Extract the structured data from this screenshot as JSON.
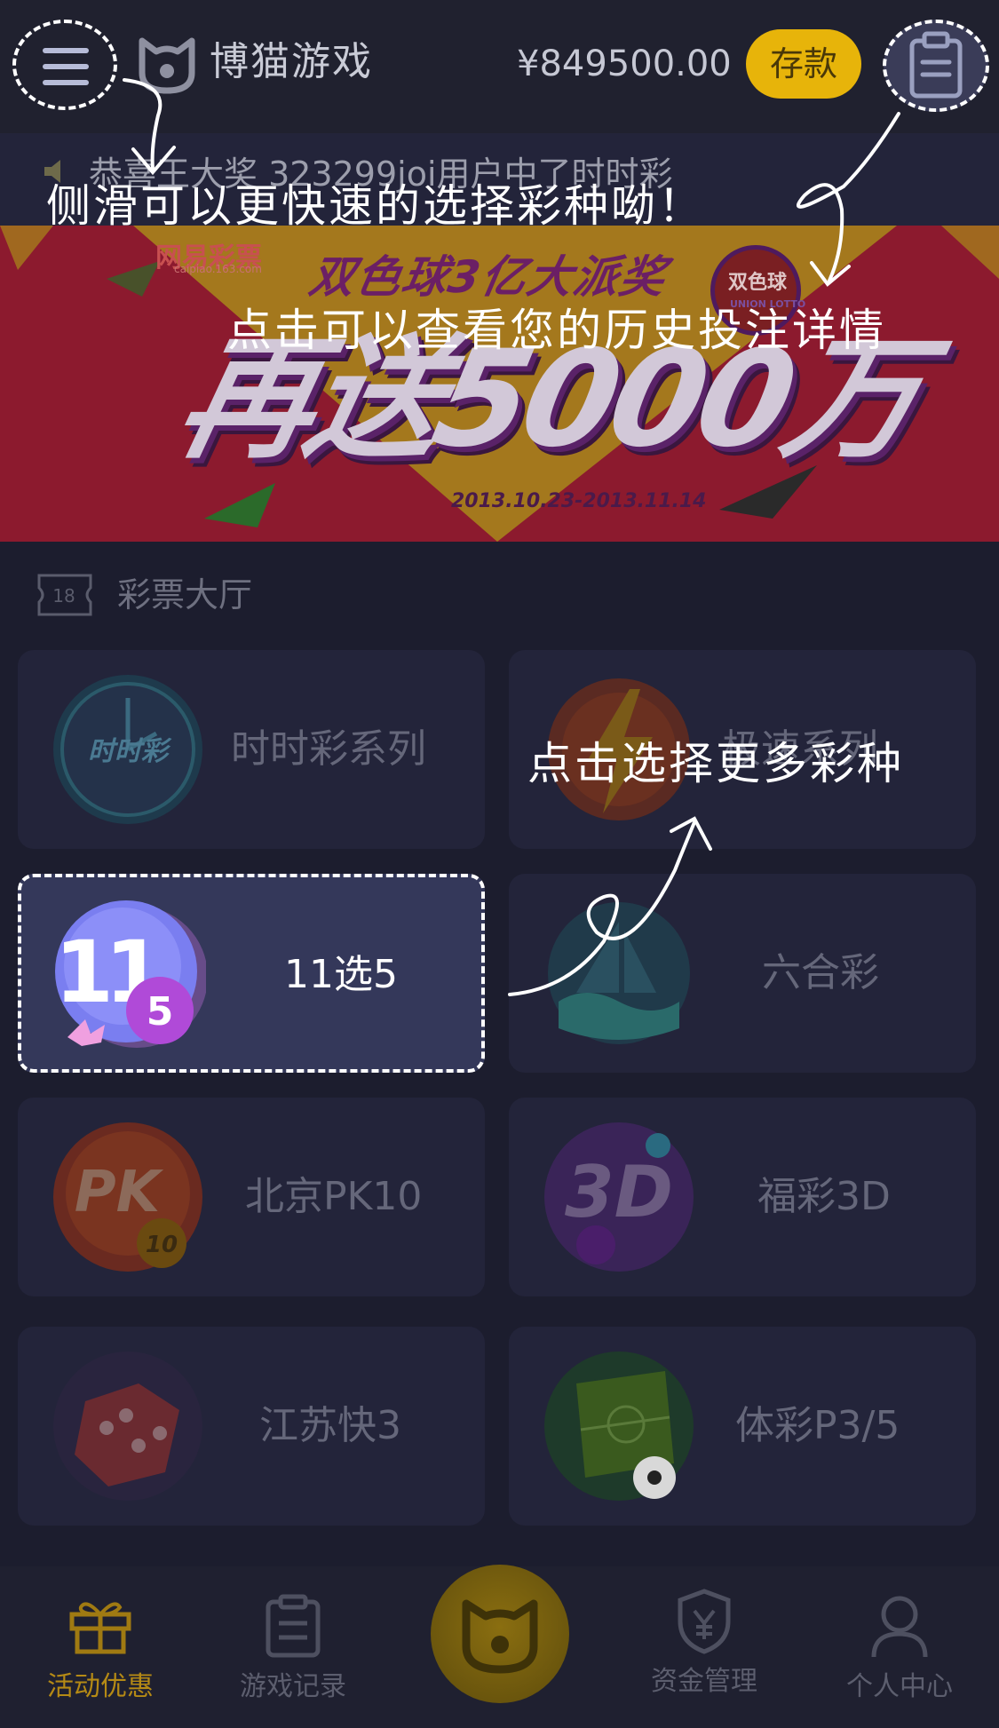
{
  "header": {
    "brand": "博猫游戏",
    "balance": "¥849500.00",
    "deposit_label": "存款"
  },
  "marquee": {
    "text": "恭喜王大奖  323299joi用户中了时时彩"
  },
  "banner": {
    "brand": "网易彩票",
    "domain": "caipiao.163.com",
    "headline": "双色球3亿大派奖",
    "big_text": "再送5000万",
    "date_range": "2013.10.23-2013.11.14",
    "badge_top": "双色球",
    "badge_bottom": "UNION LOTTO"
  },
  "section": {
    "icon_text": "18",
    "title": "彩票大厅"
  },
  "games": [
    {
      "label": "时时彩系列",
      "icon": "ssc-clock-icon",
      "icon_text": "时时彩"
    },
    {
      "label": "极速系列",
      "icon": "lightning-icon"
    },
    {
      "label": "11选5",
      "icon": "eleven-five-icon",
      "icon_text": "11",
      "badge": "5"
    },
    {
      "label": "六合彩",
      "icon": "sailboat-icon"
    },
    {
      "label": "北京PK10",
      "icon": "pk10-icon",
      "icon_text": "PK",
      "sub_text": "10"
    },
    {
      "label": "福彩3D",
      "icon": "three-d-icon",
      "icon_text": "3D"
    },
    {
      "label": "江苏快3",
      "icon": "dice-icon"
    },
    {
      "label": "体彩P3/5",
      "icon": "soccer-field-icon"
    }
  ],
  "bottom_nav": {
    "items": [
      {
        "label": "活动优惠",
        "icon": "gift-icon",
        "active": true
      },
      {
        "label": "游戏记录",
        "icon": "clipboard-icon",
        "active": false
      },
      {
        "label": "资金管理",
        "icon": "shield-yuan-icon",
        "active": false
      },
      {
        "label": "个人中心",
        "icon": "user-icon",
        "active": false
      }
    ]
  },
  "tutorial": {
    "hint_menu": "侧滑可以更快速的选择彩种呦！",
    "hint_history": "点击可以查看您的历史投注详情",
    "hint_games": "点击选择更多彩种"
  },
  "colors": {
    "background": "#1c1d2e",
    "card": "#23243a",
    "accent_gold": "#e7b40a",
    "banner_red": "#8c1a2e",
    "highlight": "#34385a"
  }
}
